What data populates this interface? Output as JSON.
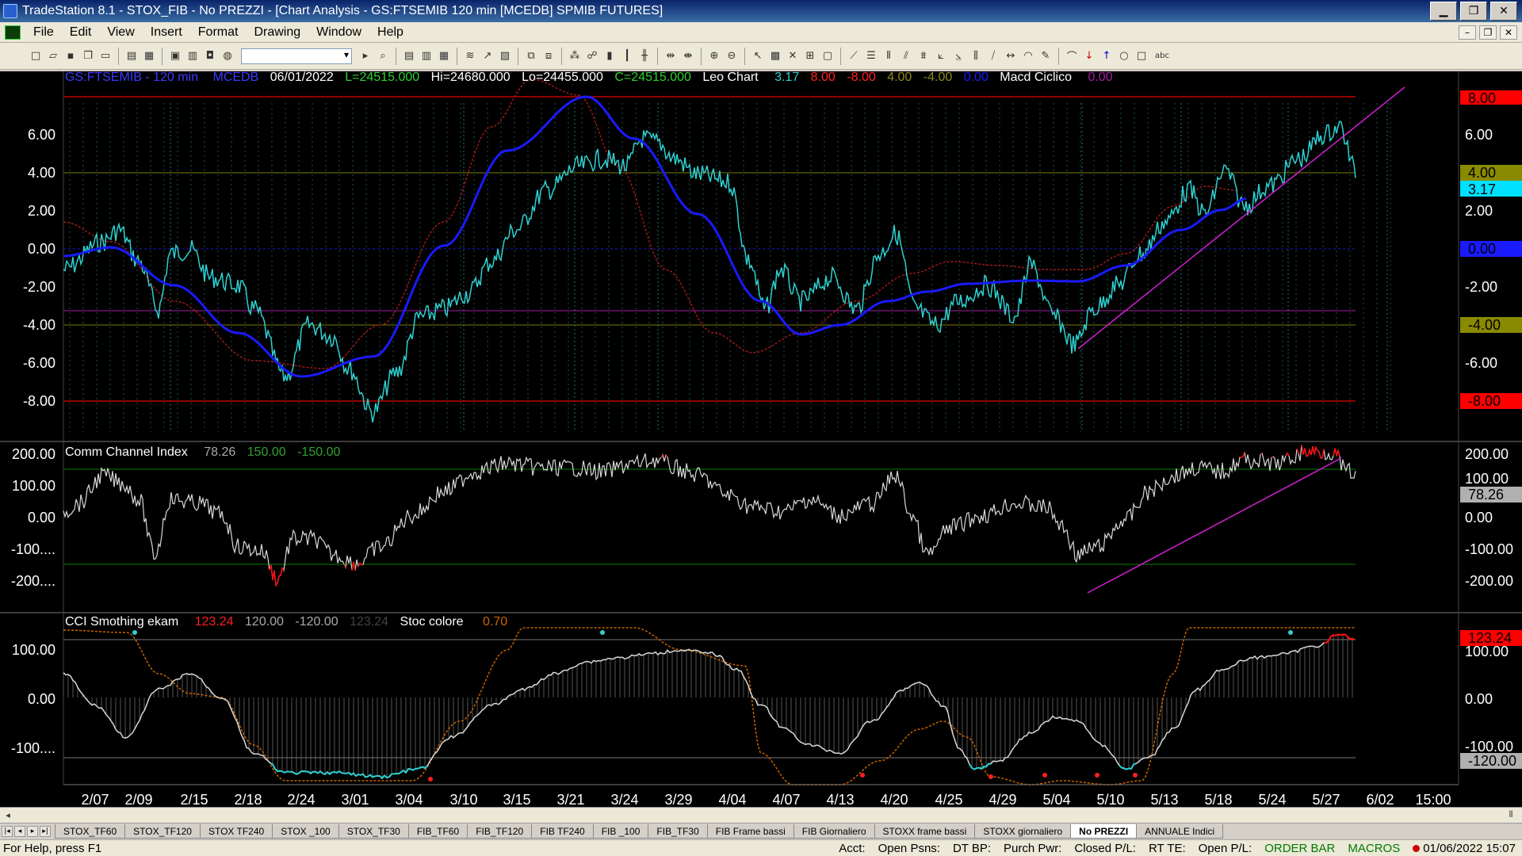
{
  "window": {
    "title": "TradeStation 8.1 - STOX_FIB - No PREZZI - [Chart Analysis - GS:FTSEMIB  120 min  [MCEDB] SPMIB FUTURES]",
    "min": "▁",
    "max": "❐",
    "close": "✕"
  },
  "menu": [
    "File",
    "Edit",
    "View",
    "Insert",
    "Format",
    "Drawing",
    "Window",
    "Help"
  ],
  "mdi_buttons": [
    "–",
    "❐",
    "✕"
  ],
  "toolbar_icons": [
    "new-icon",
    "open-icon",
    "save-icon",
    "copy-icon",
    "folder-icon",
    "print-icon",
    "printer-icon",
    "window-icon",
    "window2-icon",
    "lock-icon",
    "globe-icon"
  ],
  "price_panel": {
    "header": {
      "symbol": "GS:FTSEMIB - 120 min",
      "code": "MCEDB",
      "date": "06/01/2022",
      "low_value": "L=24515.000",
      "high": "Hi=24680.000",
      "low": "Lo=24455.000",
      "close": "C=24515.000",
      "study": "Leo Chart",
      "v1": "3.17",
      "v2": "8.00",
      "v3": "-8.00",
      "v4": "4.00",
      "v5": "-4.00",
      "v6": "0.00",
      "study2": "Macd Ciclico",
      "v7": "0.00"
    },
    "y_ticks": [
      "6.00",
      "4.00",
      "2.00",
      "0.00",
      "-2.00",
      "-4.00",
      "-6.00",
      "-8.00"
    ],
    "right_labels": {
      "top": "8.00",
      "y6": "6.00",
      "y4": "4.00",
      "last": "3.17",
      "y2": "2.00",
      "zero": "0.00",
      "m2": "-2.00",
      "m4": "-4.00",
      "m6": "-6.00",
      "m8": "-8.00"
    }
  },
  "cci_panel": {
    "header": {
      "name": "Comm Channel Index",
      "value": "78.26",
      "up": "150.00",
      "down": "-150.00"
    },
    "y_ticks": [
      "200.00",
      "100.00",
      "0.00",
      "-100....",
      "-200...."
    ],
    "right_labels": {
      "top": "200.00",
      "y100": "100.00",
      "last": "78.26",
      "zero": "0.00",
      "m100": "-100.00",
      "m200": "-200.00"
    }
  },
  "smooth_panel": {
    "header": {
      "name": "CCI Smothing ekam",
      "v1": "123.24",
      "v2": "120.00",
      "v3": "-120.00",
      "v4": "123.24",
      "stoc": "Stoc colore",
      "stoc_val": "0.70"
    },
    "y_ticks": [
      "100.00",
      "0.00",
      "-100...."
    ],
    "right_labels": {
      "last": "123.24",
      "y100": "100.00",
      "zero": "0.00",
      "m100": "-100.00",
      "m120": "-120.00"
    }
  },
  "x_axis": [
    "2/07",
    "2/09",
    "2/15",
    "2/18",
    "2/24",
    "3/01",
    "3/04",
    "3/10",
    "3/15",
    "3/21",
    "3/24",
    "3/29",
    "4/04",
    "4/07",
    "4/13",
    "4/20",
    "4/25",
    "4/29",
    "5/04",
    "5/10",
    "5/13",
    "5/18",
    "5/24",
    "5/27",
    "6/02",
    "15:00"
  ],
  "tabs": [
    "STOX_TF60",
    "STOX_TF120",
    "STOX TF240",
    "STOX _100",
    "STOX_TF30",
    "FIB_TF60",
    "FIB_TF120",
    "FIB TF240",
    "FIB _100",
    "FIB_TF30",
    "FIB Frame bassi",
    "FIB Giornaliero",
    "STOXX frame bassi",
    "STOXX giornaliero",
    "No PREZZI",
    "ANNUALE Indici"
  ],
  "active_tab": "No PREZZI",
  "status": {
    "help": "For Help, press F1",
    "acct": "Acct:",
    "open_psns": "Open Psns:",
    "dt_bp": "DT BP:",
    "purch_pwr": "Purch Pwr:",
    "closed_pl": "Closed P/L:",
    "rt_te": "RT TE:",
    "open_pl": "Open P/L:",
    "order_bar": "ORDER BAR",
    "macros": "MACROS",
    "datetime": "01/06/2022 15:07"
  },
  "colors": {
    "cyan": "#2fd0d0",
    "blue": "#1a1aff",
    "darkred": "#a01818",
    "magenta": "#d020d0",
    "white_line": "#d8d8d8",
    "red": "#ff1010",
    "orange": "#c86400",
    "green_line": "#008000"
  }
}
